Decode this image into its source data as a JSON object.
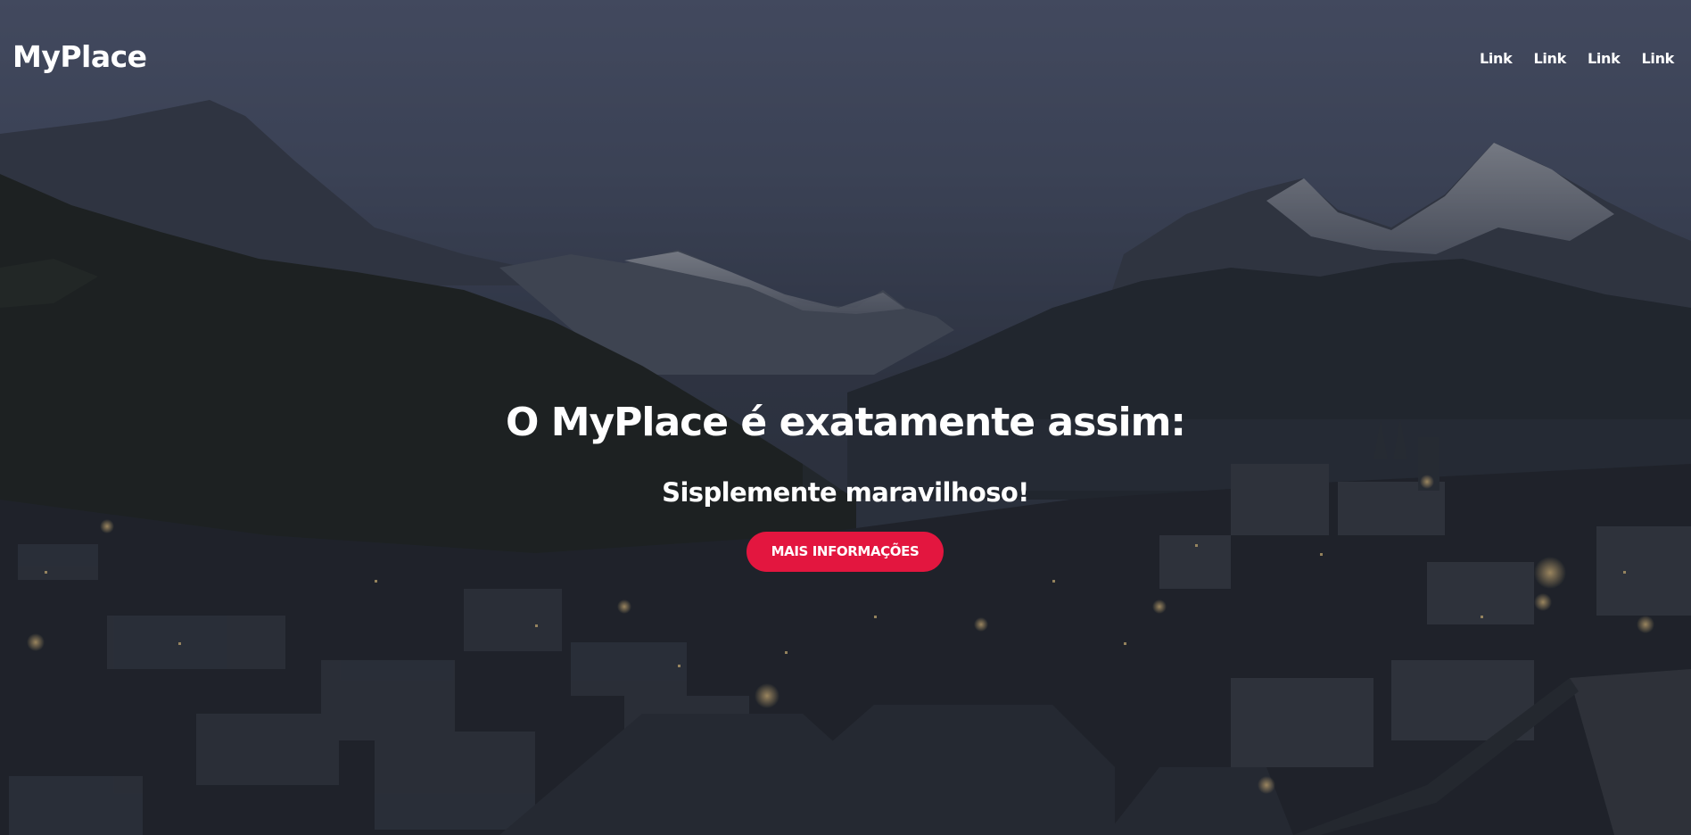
{
  "navbar": {
    "brand": "MyPlace",
    "links": [
      {
        "label": "Link"
      },
      {
        "label": "Link"
      },
      {
        "label": "Link"
      },
      {
        "label": "Link"
      }
    ]
  },
  "hero": {
    "background_image": "mountain-village-at-dusk",
    "headline": "O MyPlace é exatamente assim:",
    "subheadline": "Sisplemente maravilhoso!",
    "cta_label": "MAIS INFORMAÇÕES"
  },
  "colors": {
    "accent": "#e3163f",
    "text": "#ffffff",
    "overlay": "#1b1f27"
  }
}
